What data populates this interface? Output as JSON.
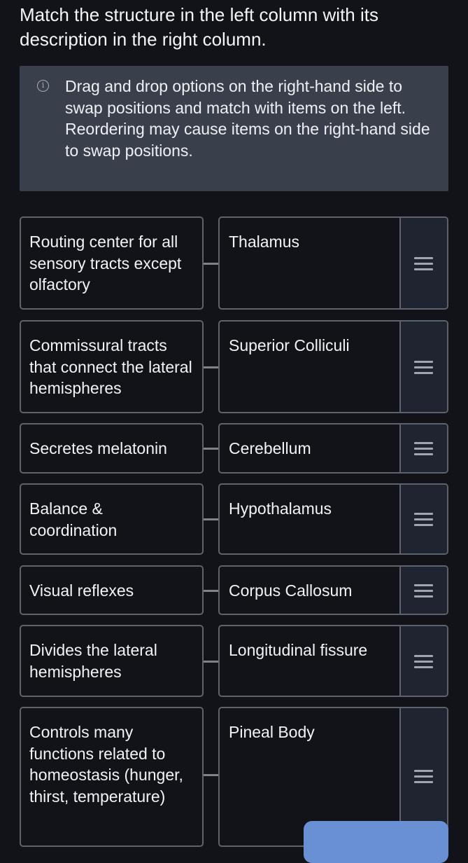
{
  "question": {
    "title": "Match the structure in the left column with its description in the right column."
  },
  "info": {
    "icon": "info-icon",
    "lines": [
      "Drag and drop options on the right-hand side to swap positions and match with items on the left.",
      "Reordering may cause items on the right-hand side to swap positions."
    ]
  },
  "pairs": [
    {
      "left": "Routing center for all sensory tracts except olfactory",
      "right": "Thalamus"
    },
    {
      "left": "Commissural tracts that connect the lateral hemispheres",
      "right": "Superior Colliculi"
    },
    {
      "left": "Secretes melatonin",
      "right": "Cerebellum"
    },
    {
      "left": "Balance & coordination",
      "right": "Hypothalamus"
    },
    {
      "left": "Visual reflexes",
      "right": "Corpus Callosum"
    },
    {
      "left": "Divides the lateral hemispheres",
      "right": "Longitudinal fissure"
    },
    {
      "left": "Controls many functions related to homeostasis (hunger, thirst, temperature)",
      "right": "Pineal Body"
    }
  ],
  "handle_icon": "drag-handle-icon",
  "colors": {
    "background": "#111318",
    "info_background": "#3a3f4c",
    "handle_background": "#1f2430",
    "border": "#5d626d",
    "accent_button": "#6a90d4"
  }
}
